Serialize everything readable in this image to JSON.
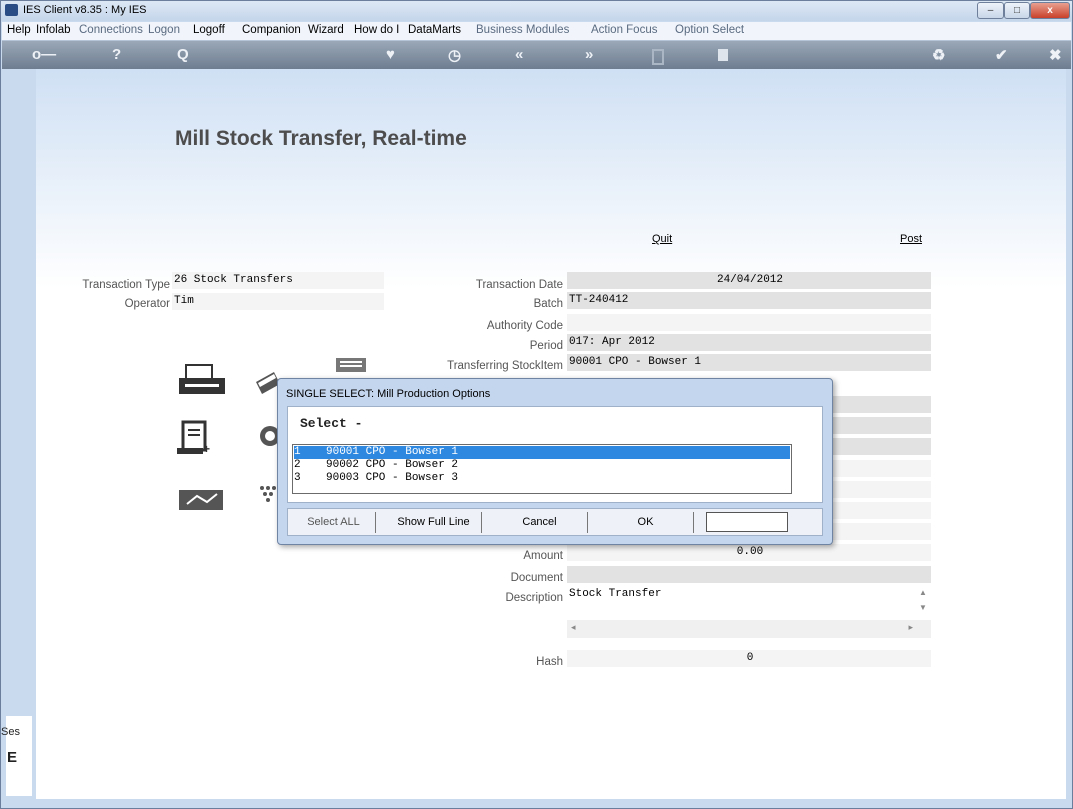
{
  "window": {
    "title": "IES Client v8.35 : My IES",
    "min": "–",
    "max": "□",
    "close": "x"
  },
  "menu": [
    "Help",
    "Infolab",
    "Connections",
    "Logon",
    "Logoff",
    "Companion",
    "Wizard",
    "How do I",
    "DataMarts",
    "Business Modules",
    "Action Focus",
    "Option Select"
  ],
  "toolbar": {
    "key": "o—",
    "help": "?",
    "search": "Q",
    "heart": "♥",
    "clock": "◷",
    "back": "«",
    "fwd": "»",
    "recycle": "♻",
    "check": "✔",
    "close": "✖"
  },
  "page": {
    "title": "Mill Stock Transfer, Real-time",
    "quit": "Quit",
    "post": "Post"
  },
  "form": {
    "transaction_type_label": "Transaction Type",
    "transaction_type": "26 Stock Transfers",
    "operator_label": "Operator",
    "operator": "Tim",
    "transaction_date_label": "Transaction Date",
    "transaction_date": "24/04/2012",
    "batch_label": "Batch",
    "batch": "TT-240412",
    "authority_code_label": "Authority Code",
    "authority_code": "",
    "period_label": "Period",
    "period": "017: Apr 2012",
    "transferring_label": "Transferring StockItem",
    "transferring": "90001 CPO - Bowser 1",
    "amount_label": "Amount",
    "amount": "0.00",
    "document_label": "Document",
    "document": "",
    "description_label": "Description",
    "description": "Stock Transfer",
    "hash_label": "Hash",
    "hash": "0"
  },
  "dialog": {
    "title": "SINGLE SELECT: Mill Production Options",
    "heading": "Select -",
    "options": [
      {
        "num": "1",
        "text": "90001 CPO - Bowser 1"
      },
      {
        "num": "2",
        "text": "90002 CPO - Bowser 2"
      },
      {
        "num": "3",
        "text": "90003 CPO - Bowser 3"
      }
    ],
    "selected_index": 0,
    "buttons": {
      "select_all": "Select ALL",
      "show_full_line": "Show Full Line",
      "cancel": "Cancel",
      "ok": "OK"
    },
    "input_value": ""
  },
  "side": {
    "session_label": "Ses"
  }
}
